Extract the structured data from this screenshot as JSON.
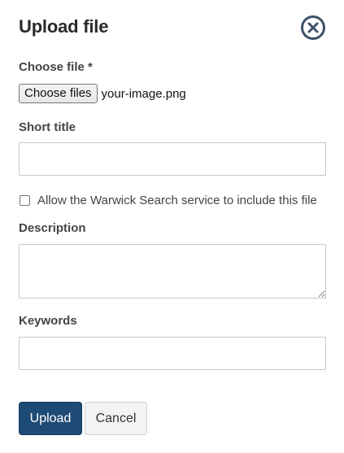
{
  "dialog": {
    "title": "Upload file",
    "close_icon": "close-circle-icon"
  },
  "choose_file": {
    "label": "Choose file *",
    "button_label": "Choose files",
    "selected_file": "your-image.png"
  },
  "short_title": {
    "label": "Short title",
    "value": "",
    "placeholder": ""
  },
  "search_option": {
    "label": "Allow the Warwick Search service to include this file",
    "checked": false
  },
  "description": {
    "label": "Description",
    "value": ""
  },
  "keywords": {
    "label": "Keywords",
    "value": ""
  },
  "actions": {
    "upload_label": "Upload",
    "cancel_label": "Cancel"
  },
  "colors": {
    "primary": "#1e4a76",
    "close_icon": "#3d5168",
    "text": "#444444"
  }
}
